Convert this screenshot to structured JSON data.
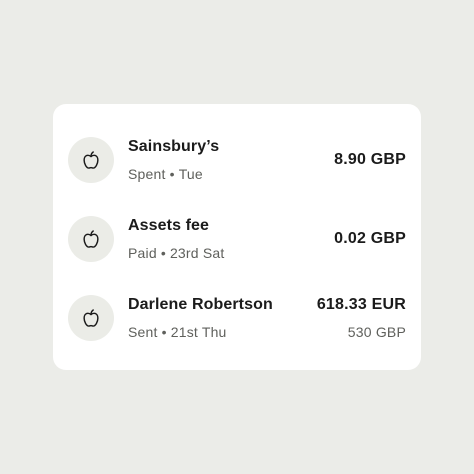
{
  "transactions": [
    {
      "icon": "apple-icon",
      "name": "Sainsbury’s",
      "status": "Spent",
      "date": "Tue",
      "amount": "8.90 GBP",
      "secondary_amount": ""
    },
    {
      "icon": "apple-icon",
      "name": "Assets fee",
      "status": "Paid",
      "date": "23rd Sat",
      "amount": "0.02 GBP",
      "secondary_amount": ""
    },
    {
      "icon": "apple-icon",
      "name": "Darlene Robertson",
      "status": "Sent",
      "date": "21st Thu",
      "amount": "618.33 EUR",
      "secondary_amount": "530 GBP"
    }
  ],
  "separator": "•",
  "colors": {
    "background": "#ebece8",
    "card": "#ffffff",
    "avatar": "#ebece7",
    "primary_text": "#1b1b1b",
    "secondary_text": "#5f605c"
  }
}
